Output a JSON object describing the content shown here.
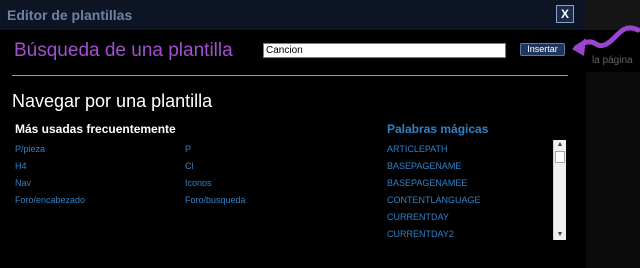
{
  "dialog": {
    "title": "Editor de plantillas",
    "close_label": "X"
  },
  "search": {
    "label": "Búsqueda de una plantilla",
    "value": "Cancion",
    "insert_label": "Insertar"
  },
  "browse": {
    "label": "Navegar por una plantilla"
  },
  "frequent": {
    "heading": "Más usadas frecuentemente",
    "col1": [
      "P/pieza",
      "H4",
      "Nav",
      "Foro/encabezado"
    ],
    "col2": [
      "P",
      "Cl",
      "Iconos",
      "Foro/busqueda"
    ]
  },
  "magic_words": {
    "heading": "Palabras mágicas",
    "items": [
      "ARTICLEPATH",
      "BASEPAGENAME",
      "BASEPAGENAMEE",
      "CONTENTLANGUAGE",
      "CURRENTDAY",
      "CURRENTDAY2"
    ]
  },
  "background": {
    "partial_text": "la página"
  },
  "colors": {
    "accent_purple": "#a24fd0",
    "link_blue": "#2f82c7",
    "titlebar": "#0d1423"
  },
  "icons": {
    "close": "close-icon",
    "arrow": "arrow-pointer-icon",
    "scroll_up": "scroll-up-icon",
    "scroll_down": "scroll-down-icon"
  }
}
